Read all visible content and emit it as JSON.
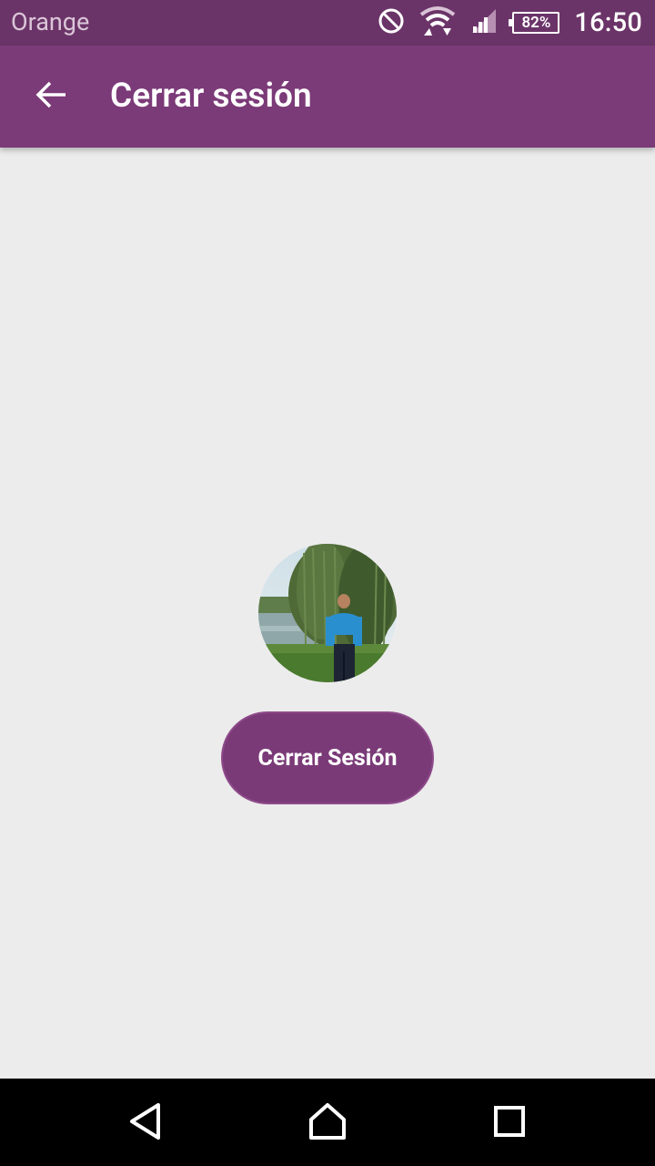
{
  "status_bar": {
    "carrier": "Orange",
    "battery_level": "82%",
    "time": "16:50"
  },
  "app_bar": {
    "title": "Cerrar sesión"
  },
  "main": {
    "logout_label": "Cerrar Sesión"
  },
  "icons": {
    "dnd": "do-not-disturb-icon",
    "wifi": "wifi-icon",
    "signal": "cell-signal-icon",
    "battery": "battery-icon",
    "back": "arrow-back-icon",
    "nav_back": "nav-back-icon",
    "nav_home": "nav-home-icon",
    "nav_recents": "nav-recents-icon"
  },
  "colors": {
    "status_bar": "#6b3468",
    "primary": "#7b3a78",
    "background": "#ececec"
  }
}
